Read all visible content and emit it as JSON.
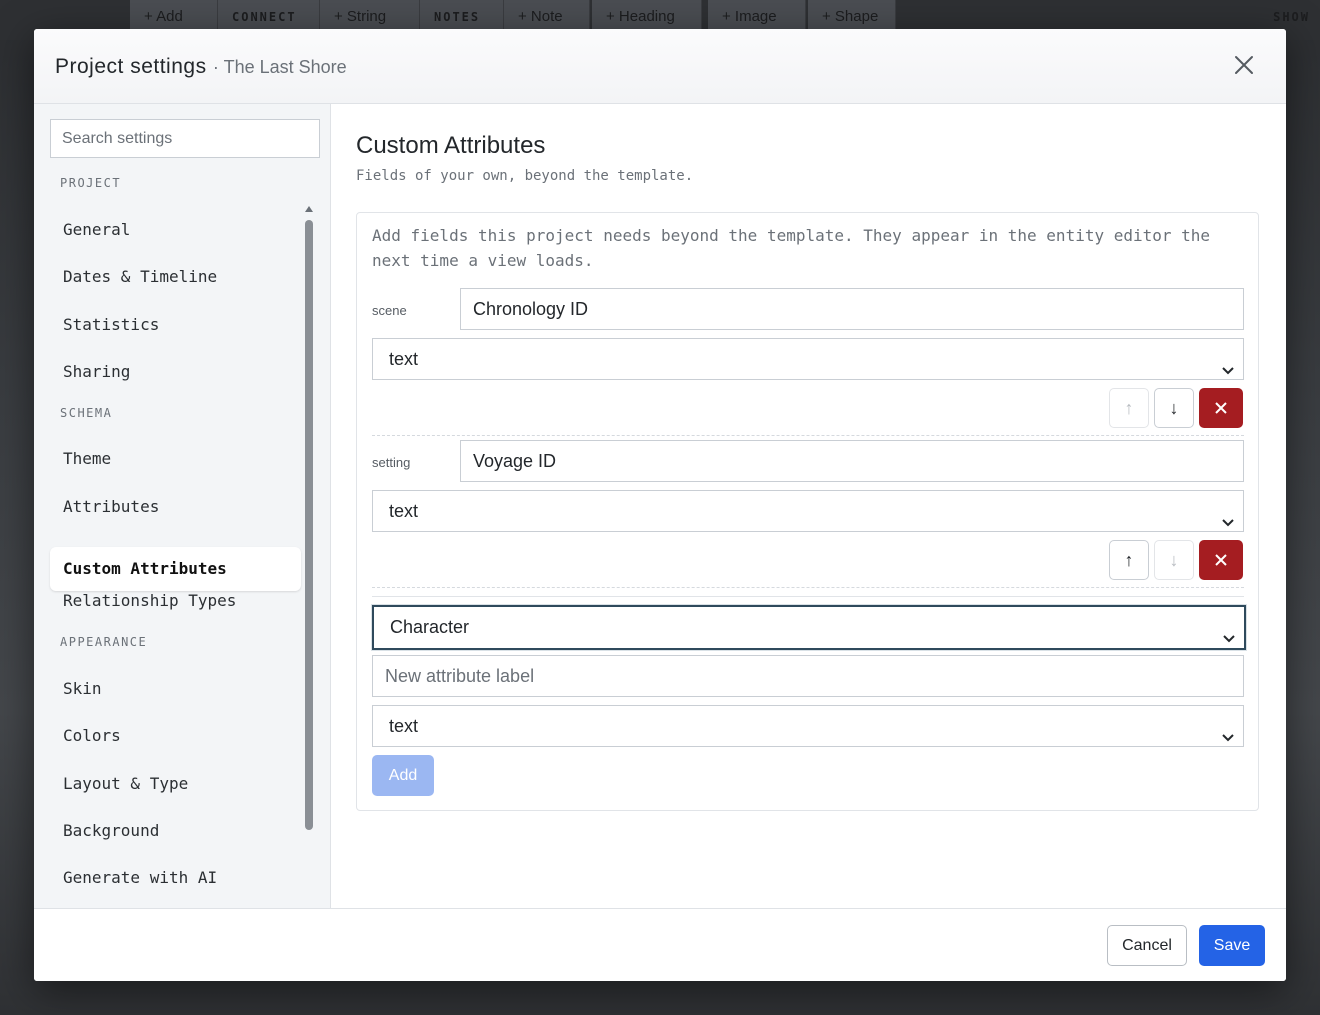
{
  "toolbar": {
    "add": "+ Add",
    "connect": "CONNECT",
    "string": "+ String",
    "notes": "NOTES",
    "note": "+ Note",
    "heading": "+ Heading",
    "image": "+ Image",
    "shape": "+ Shape",
    "show": "SHOW"
  },
  "modal": {
    "title": "Project settings",
    "subtitle": "· The Last Shore"
  },
  "sidebar": {
    "search_placeholder": "Search settings",
    "sections": [
      {
        "title": "PROJECT",
        "items": [
          "General",
          "Dates & Timeline",
          "Statistics",
          "Sharing"
        ]
      },
      {
        "title": "SCHEMA",
        "items": [
          "Theme",
          "Attributes",
          "Custom Attributes",
          "Relationship Types"
        ]
      },
      {
        "title": "APPEARANCE",
        "items": [
          "Skin",
          "Colors",
          "Layout & Type",
          "Background",
          "Generate with AI"
        ]
      }
    ],
    "active_item": "Custom Attributes"
  },
  "content": {
    "title": "Custom Attributes",
    "subtitle": "Fields of your own, beyond the template.",
    "description": "Add fields this project needs beyond the template. They appear in the entity editor the next time a view loads.",
    "attributes": [
      {
        "scope": "scene",
        "label": "Chronology ID",
        "type": "text"
      },
      {
        "scope": "setting",
        "label": "Voyage ID",
        "type": "text"
      }
    ],
    "new_attribute": {
      "entity": "Character",
      "label_placeholder": "New attribute label",
      "type": "text",
      "add_label": "Add"
    }
  },
  "footer": {
    "cancel": "Cancel",
    "save": "Save"
  },
  "colors": {
    "primary": "#2463e6",
    "danger": "#a51d21",
    "add_disabled": "#9bb7f2"
  }
}
